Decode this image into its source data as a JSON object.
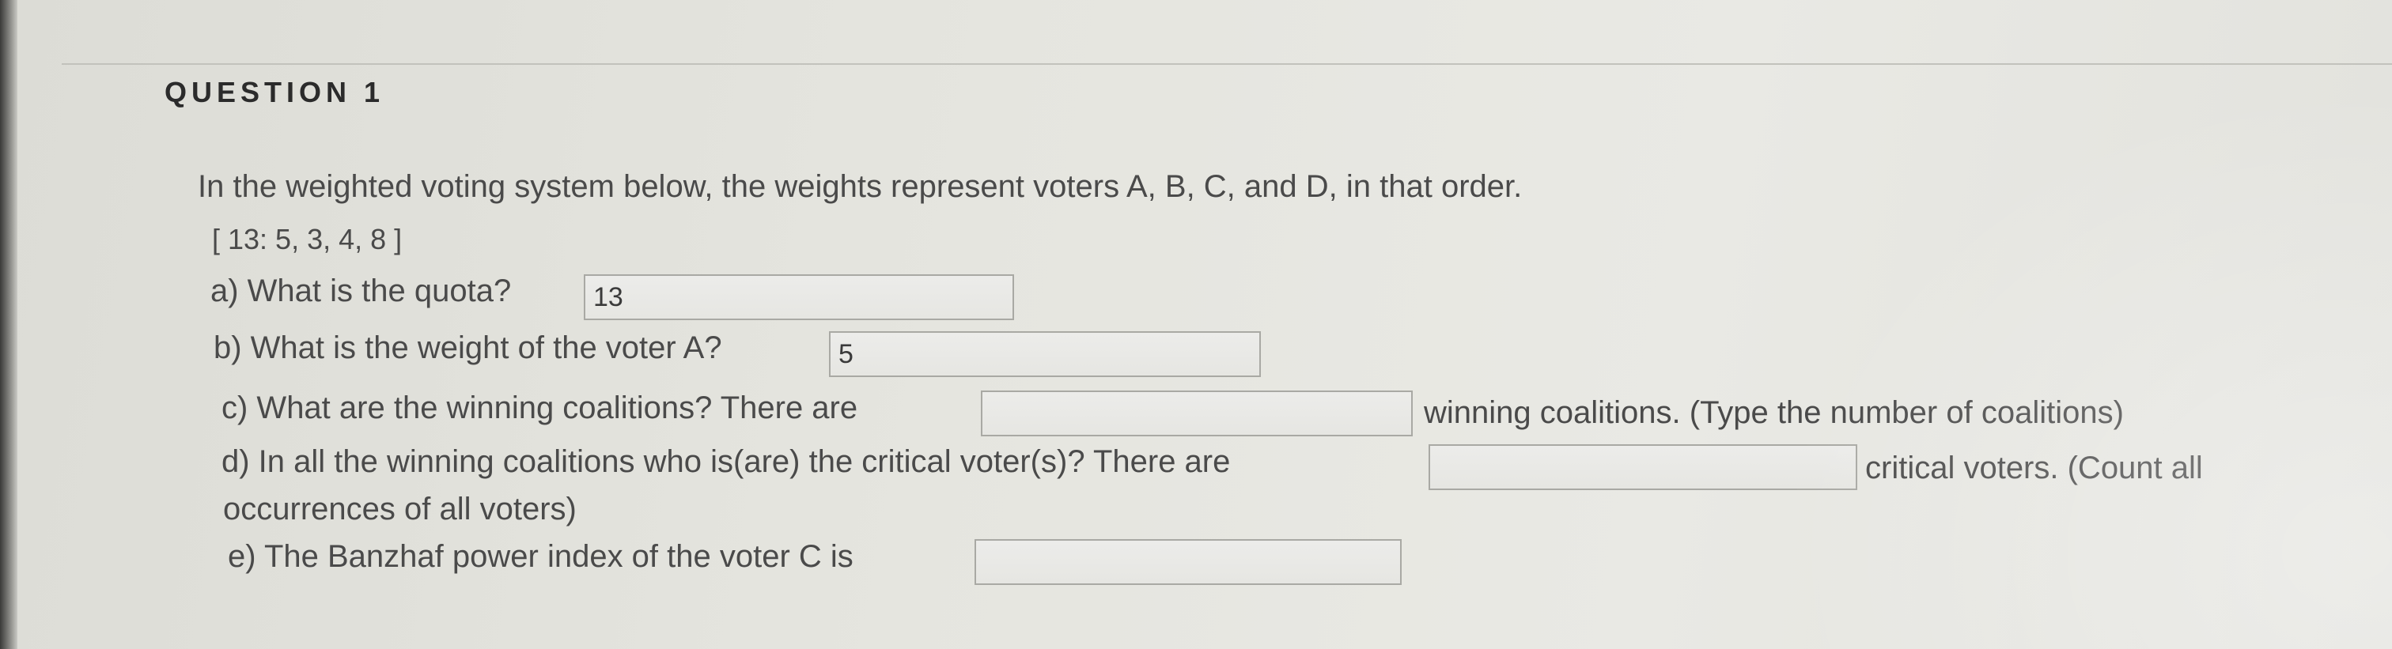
{
  "question": {
    "title": "QUESTION 1",
    "intro": "In the weighted voting system below, the weights represent voters A, B, C, and D, in that order.",
    "system": "[ 13: 5, 3, 4, 8 ]",
    "parts": {
      "a": {
        "prompt": "a) What is the quota?",
        "value": "13"
      },
      "b": {
        "prompt": "b) What is the weight of the voter A?",
        "value": "5"
      },
      "c": {
        "prompt": "c) What are the winning coalitions? There are",
        "value": "",
        "suffix": "winning coalitions. (Type the number of coalitions)"
      },
      "d": {
        "prompt": "d) In all the winning coalitions who is(are) the critical voter(s)? There are",
        "value": "",
        "suffix": "critical voters. (Count all",
        "suffix_line2": "occurrences of all voters)"
      },
      "e": {
        "prompt": "e) The Banzhaf power index of the voter C is",
        "value": ""
      }
    }
  }
}
